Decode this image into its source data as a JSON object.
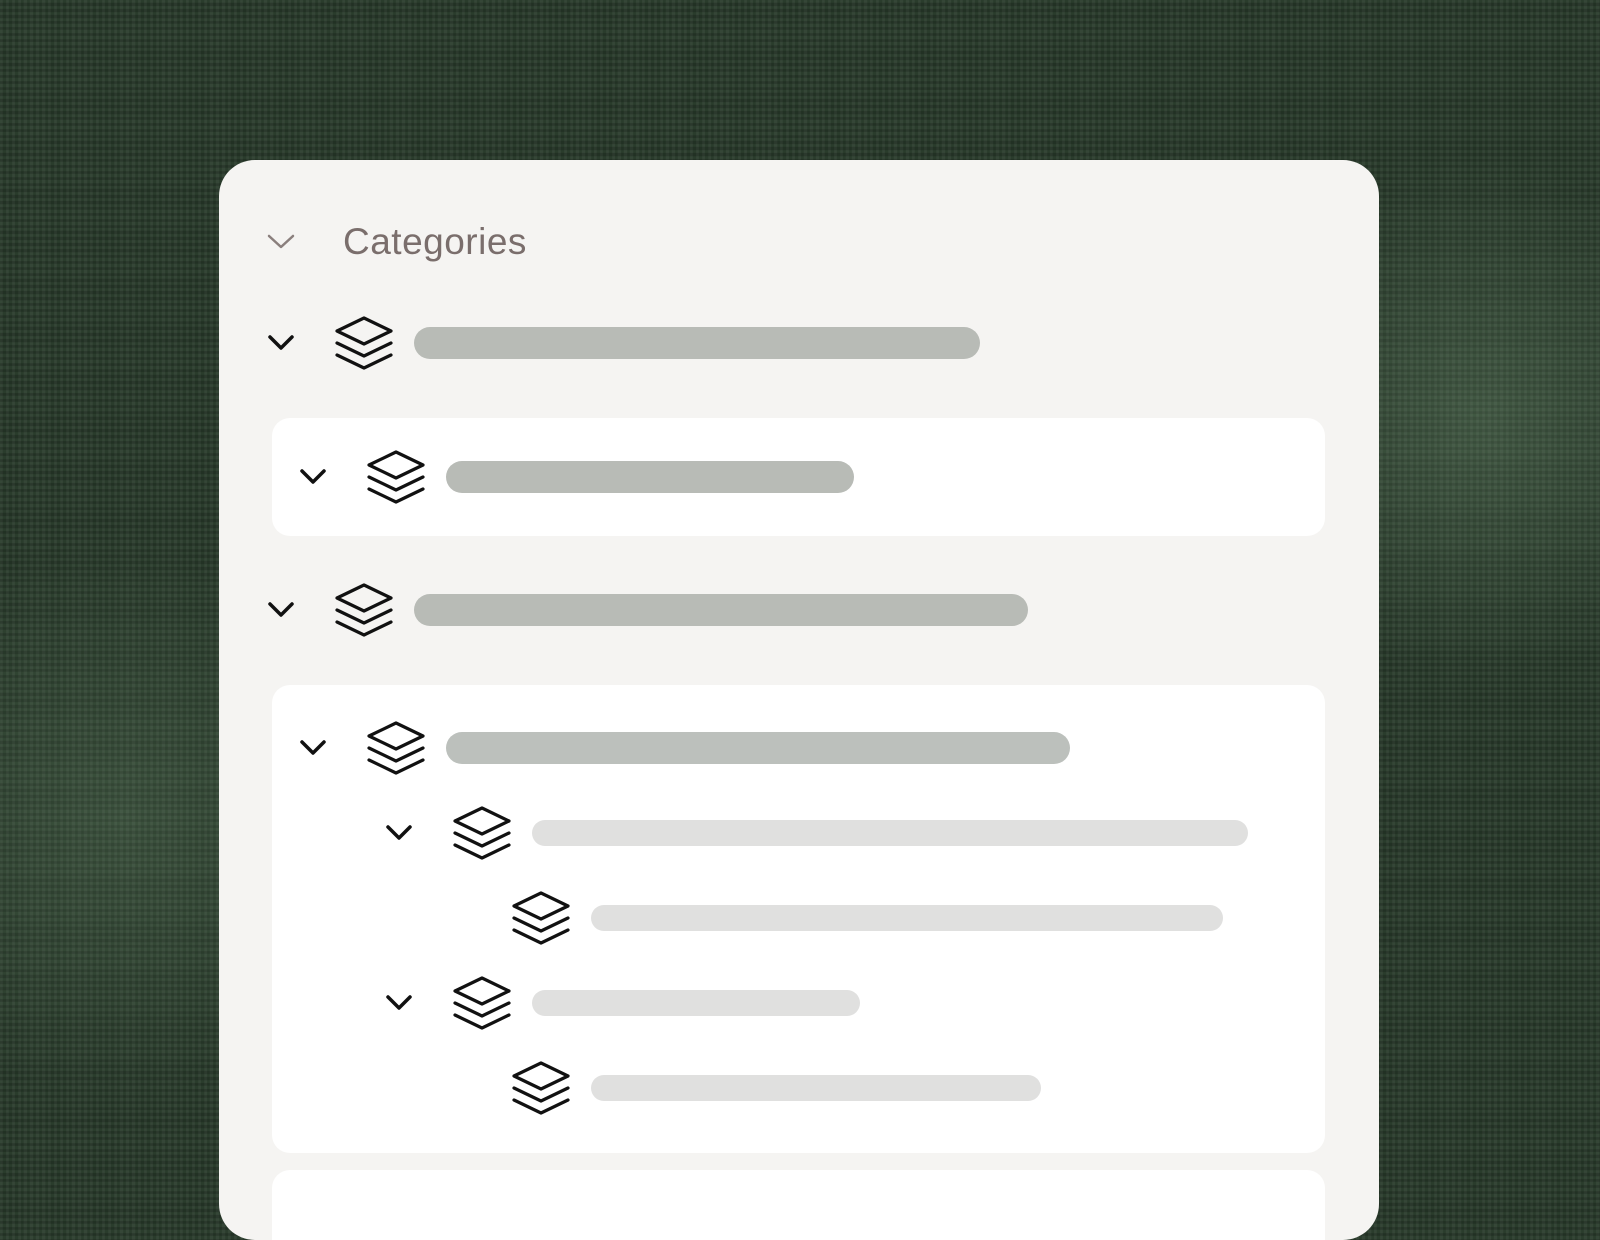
{
  "panel": {
    "title": "Categories",
    "collapse_icon": "chevron-down-icon"
  },
  "colors": {
    "background": "#2a3c2c",
    "panel": "#f5f4f2",
    "card": "#ffffff",
    "placeholder_primary": "#b8bbb6",
    "placeholder_secondary": "#e0e0df",
    "title_text": "#7a6e6c"
  },
  "tree": {
    "item_icon": "layers-icon",
    "expander_icon": "chevron-down-icon",
    "items": [
      {
        "level": 0,
        "expanded": true,
        "label": "",
        "placeholder": "loading"
      },
      {
        "level": 1,
        "expanded": true,
        "label": "",
        "placeholder": "loading"
      },
      {
        "level": 0,
        "expanded": true,
        "label": "",
        "placeholder": "loading"
      },
      {
        "level": 1,
        "expanded": true,
        "label": "",
        "placeholder": "loading"
      },
      {
        "level": 2,
        "expanded": true,
        "label": "",
        "placeholder": "loading"
      },
      {
        "level": 3,
        "expanded": false,
        "label": "",
        "placeholder": "loading"
      },
      {
        "level": 2,
        "expanded": true,
        "label": "",
        "placeholder": "loading"
      },
      {
        "level": 3,
        "expanded": false,
        "label": "",
        "placeholder": "loading"
      }
    ]
  }
}
